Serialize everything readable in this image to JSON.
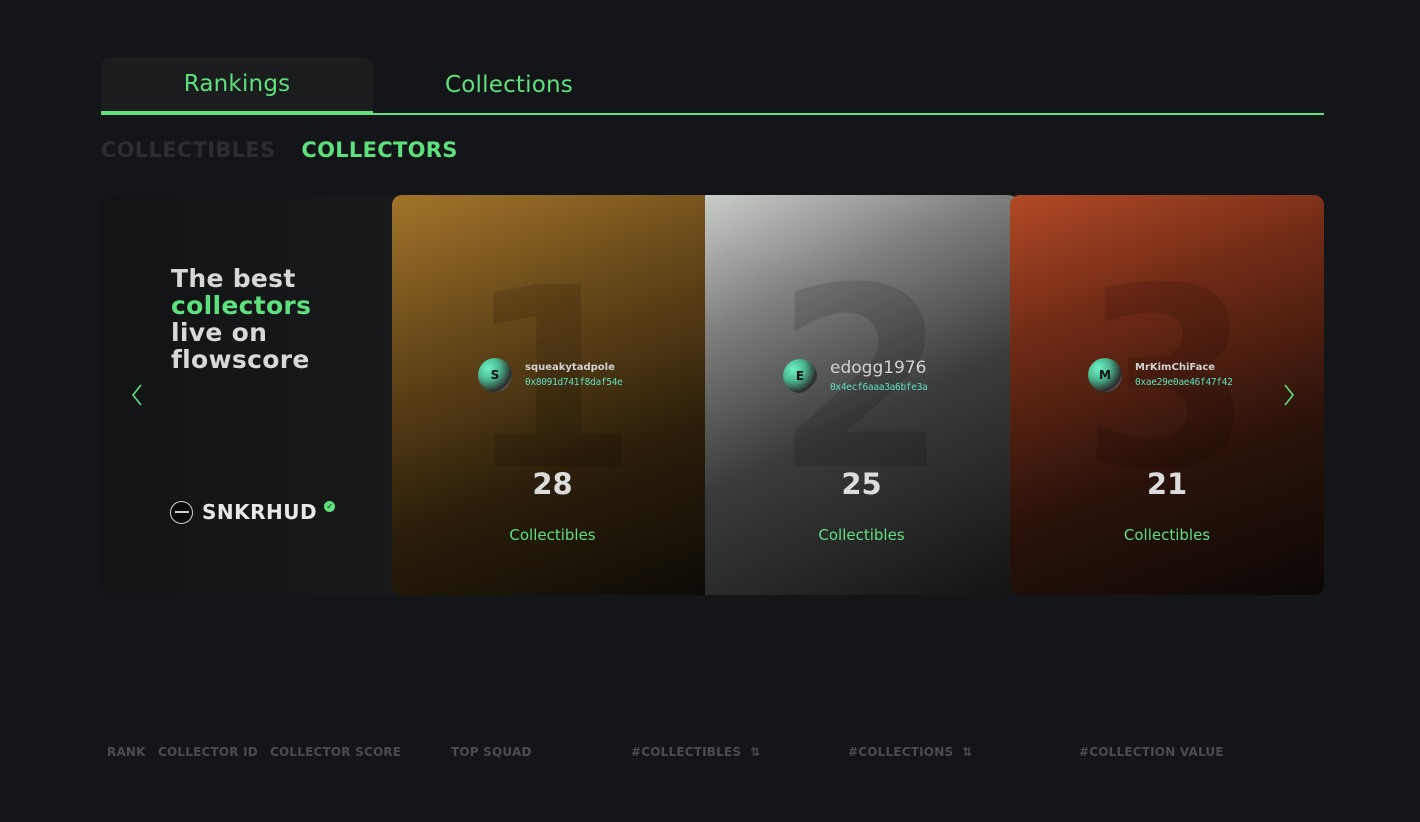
{
  "tabs": [
    {
      "label": "Rankings",
      "active": true
    },
    {
      "label": "Collections",
      "active": false
    }
  ],
  "subtabs": [
    {
      "label": "COLLECTIBLES",
      "active": false
    },
    {
      "label": "COLLECTORS",
      "active": true
    }
  ],
  "intro": {
    "line1": "The best",
    "line2": "collectors",
    "line3": "live on",
    "line4": "flowscore",
    "brand_name": "SNKRHUD",
    "verified_icon": "✓"
  },
  "cards": [
    {
      "rank": "1",
      "name": "squeakytadpole",
      "address": "0x8091d741f8daf54e",
      "initial": "S",
      "count": "28",
      "count_label": "Collectibles"
    },
    {
      "rank": "2",
      "name": "edogg1976",
      "address": "0x4ecf6aaa3a6bfe3a",
      "initial": "E",
      "count": "25",
      "count_label": "Collectibles"
    },
    {
      "rank": "3",
      "name": "MrKimChiFace",
      "address": "0xae29e0ae46f47f42",
      "initial": "M",
      "count": "21",
      "count_label": "Collectibles"
    }
  ],
  "table_header": {
    "rank": "RANK",
    "collector_id": "COLLECTOR ID",
    "collector_score": "COLLECTOR SCORE",
    "top_squad": "TOP SQUAD",
    "collectibles": "#COLLECTIBLES",
    "collections": "#COLLECTIONS",
    "collection_value": "#COLLECTION VALUE",
    "sort_icon": "⇅"
  },
  "colors": {
    "accent": "#5ee07d",
    "background": "#131519",
    "address": "#5ee0c0"
  }
}
